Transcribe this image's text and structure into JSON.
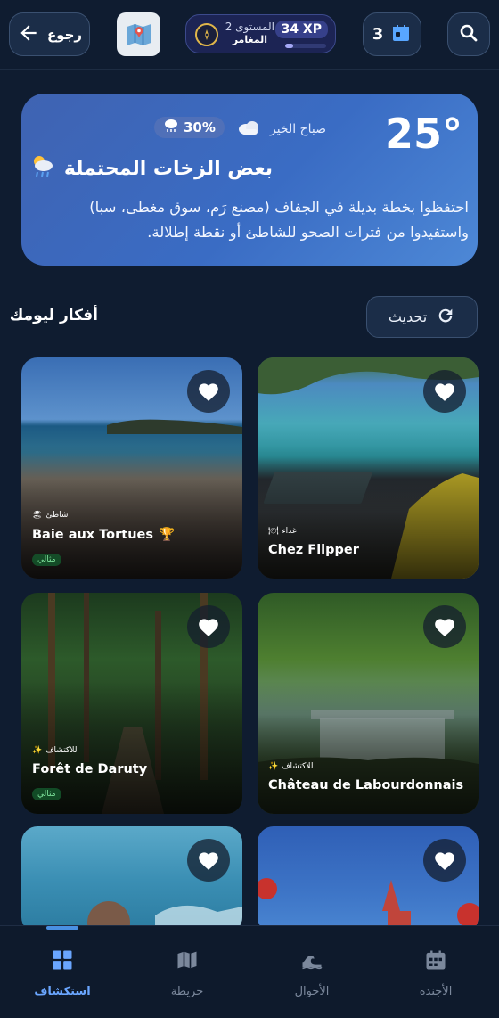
{
  "header": {
    "back_label": "رجوع",
    "level_label": "المستوى 2",
    "rank_label": "المغامر",
    "xp_label": "34 XP",
    "xp_progress": 0.2,
    "calendar_count": "3"
  },
  "weather": {
    "temperature": "25°",
    "greeting": "صباح الخير",
    "rain_chance": "30%",
    "title": "بعض الزخات المحتملة",
    "description": "احتفظوا بخطة بديلة في الجفاف (مصنع رَم، سوق مغطى، سبا) واستفيدوا من فترات الصحو للشاطئ أو نقطة إطلالة."
  },
  "section": {
    "title": "أفكار ليومك",
    "refresh_label": "تحديث"
  },
  "cards": [
    {
      "category": "شاطئ",
      "name": "Baie aux Tortues",
      "trophy": "🏆",
      "badge": "مثالي",
      "cat_emoji": "🏖"
    },
    {
      "category": "غداء",
      "name": "Chez Flipper",
      "trophy": "",
      "badge": "",
      "cat_emoji": "🍽"
    },
    {
      "category": "للاكتشاف",
      "name": "Forêt de Daruty",
      "trophy": "",
      "badge": "مثالي",
      "cat_emoji": "✨"
    },
    {
      "category": "للاكتشاف",
      "name": "Château de Labourdonnais",
      "trophy": "",
      "badge": "",
      "cat_emoji": "✨"
    }
  ],
  "nav": {
    "items": [
      {
        "label": "استكشاف"
      },
      {
        "label": "خريطة"
      },
      {
        "label": "الأحوال"
      },
      {
        "label": "الأجندة"
      }
    ]
  }
}
